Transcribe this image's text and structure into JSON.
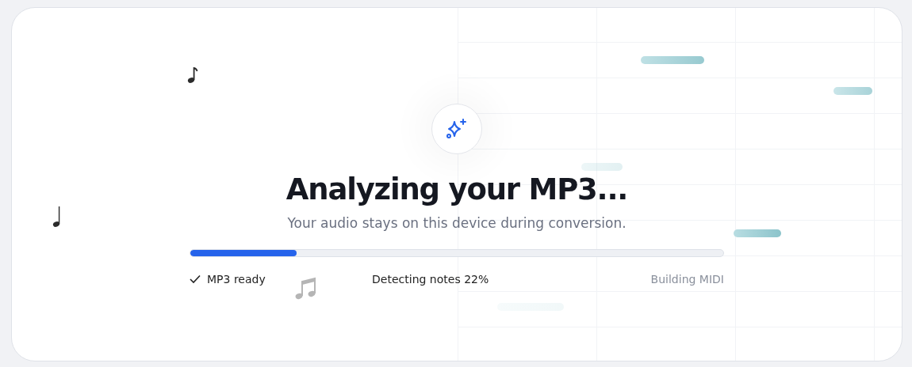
{
  "status": {
    "title": "Analyzing your MP3...",
    "subtitle": "Your audio stays on this device during conversion."
  },
  "progress": {
    "level": 0.2
  },
  "steps": [
    {
      "label": "MP3 ready",
      "kind": "done"
    },
    {
      "label": "Detecting notes 22%",
      "kind": "active"
    },
    {
      "label": "Building MIDI",
      "kind": "pending"
    }
  ]
}
